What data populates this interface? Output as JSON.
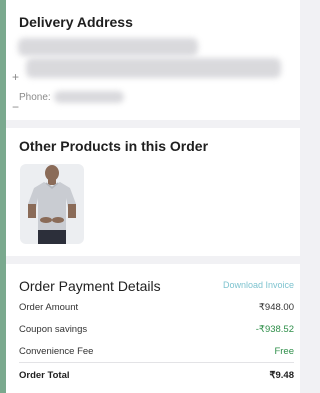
{
  "address": {
    "title": "Delivery Address",
    "phone_label": "Phone:",
    "plus_glyph": "+",
    "minus_glyph": "−"
  },
  "products": {
    "title": "Other Products in this Order",
    "items": [
      {
        "image_icon": "tshirt-icon",
        "shirt_color": "#c9ccd2"
      }
    ]
  },
  "payment": {
    "title": "Order Payment Details",
    "download_label": "Download Invoice",
    "rows": [
      {
        "label": "Order Amount",
        "value": "₹948.00"
      },
      {
        "label": "Coupon savings",
        "value": "-₹938.52"
      },
      {
        "label": "Convenience Fee",
        "value": "Free"
      }
    ],
    "total": {
      "label": "Order Total",
      "value": "₹9.48"
    }
  },
  "colors": {
    "accent_link": "#7ec3cf",
    "savings_green": "#2f8f4a",
    "background": "#f1f1f4"
  }
}
